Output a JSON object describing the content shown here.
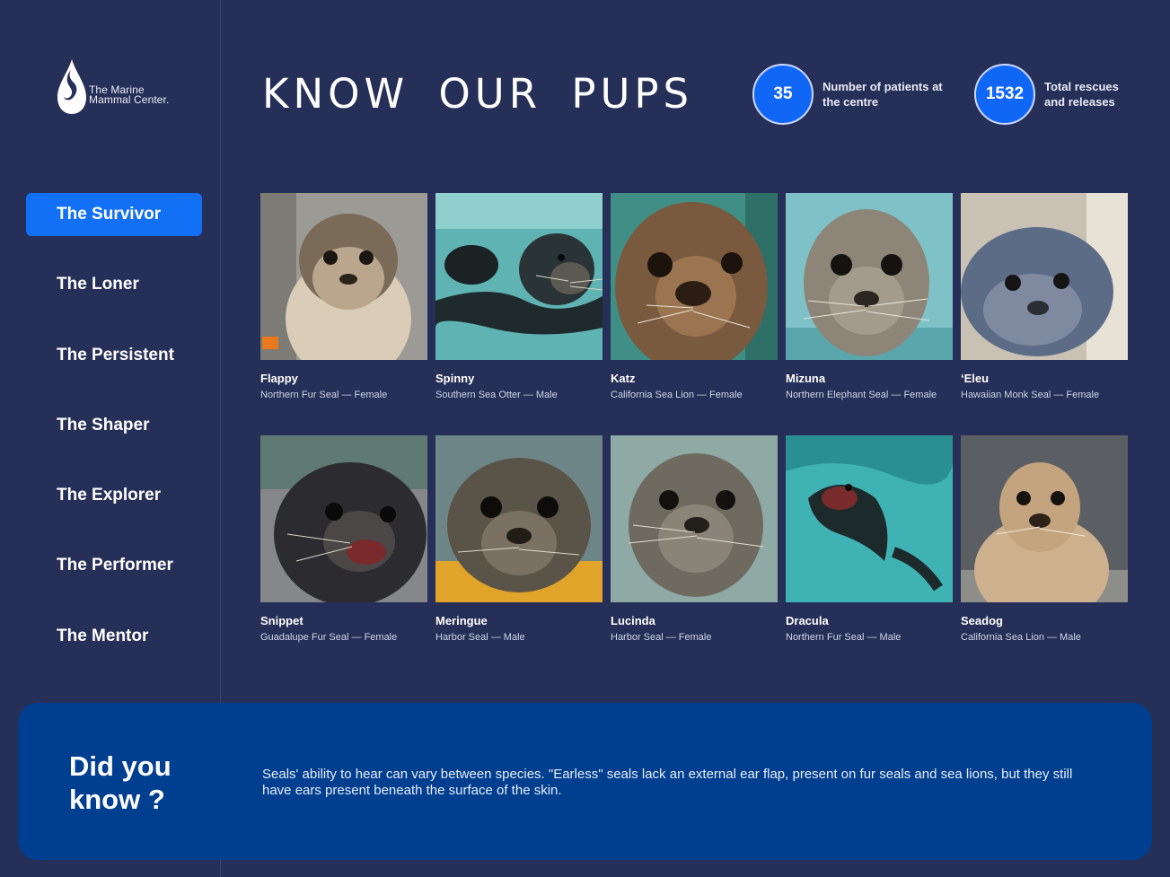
{
  "logo": {
    "line1": "The Marine",
    "line2": "Mammal Center."
  },
  "header": {
    "title": "KNOW OUR PUPS"
  },
  "stats": [
    {
      "value": "35",
      "label": "Number of patients at the centre"
    },
    {
      "value": "1532",
      "label": "Total rescues and releases"
    }
  ],
  "nav": {
    "items": [
      {
        "label": "The Survivor",
        "active": true
      },
      {
        "label": "The Loner"
      },
      {
        "label": "The Persistent"
      },
      {
        "label": "The Shaper"
      },
      {
        "label": "The Explorer"
      },
      {
        "label": "The Performer"
      },
      {
        "label": "The Mentor"
      }
    ]
  },
  "pups": [
    {
      "name": "Flappy",
      "desc": "Northern Fur Seal — Female"
    },
    {
      "name": "Spinny",
      "desc": "Southern Sea Otter — Male"
    },
    {
      "name": "Katz",
      "desc": "California Sea Lion — Female"
    },
    {
      "name": "Mizuna",
      "desc": "Northern Elephant Seal — Female"
    },
    {
      "name": "‘Eleu",
      "desc": "Hawaiian Monk Seal — Female"
    },
    {
      "name": "Snippet",
      "desc": "Guadalupe Fur Seal — Female"
    },
    {
      "name": "Meringue",
      "desc": "Harbor Seal — Male"
    },
    {
      "name": "Lucinda",
      "desc": "Harbor Seal — Female"
    },
    {
      "name": "Dracula",
      "desc": "Northern Fur Seal — Male"
    },
    {
      "name": "Seadog",
      "desc": "California Sea Lion — Male"
    }
  ],
  "fact": {
    "title": "Did you know ?",
    "text": "Seals' ability to hear can vary between species. \"Earless\" seals lack an external ear flap, present on fur seals and sea lions, but they still have ears present beneath the surface of the skin."
  },
  "colors": {
    "background": "#262f57",
    "accent": "#1270f7",
    "fact_panel": "#003f8f"
  }
}
